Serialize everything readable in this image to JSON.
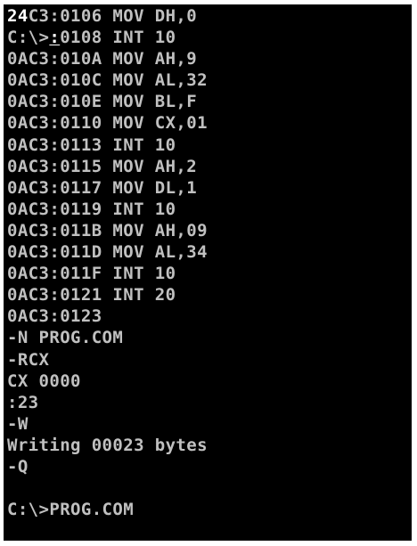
{
  "console": {
    "lines": [
      {
        "pre": "",
        "bright": "24",
        "rest": "C3:0106 MOV DH,0"
      },
      {
        "pre": "C:\\>",
        "under": ":",
        "rest": "0108 INT 10"
      },
      {
        "text": "0AC3:010A MOV AH,9"
      },
      {
        "text": "0AC3:010C MOV AL,32"
      },
      {
        "text": "0AC3:010E MOV BL,F"
      },
      {
        "text": "0AC3:0110 MOV CX,01"
      },
      {
        "text": "0AC3:0113 INT 10"
      },
      {
        "text": "0AC3:0115 MOV AH,2"
      },
      {
        "text": "0AC3:0117 MOV DL,1"
      },
      {
        "text": "0AC3:0119 INT 10"
      },
      {
        "text": "0AC3:011B MOV AH,09"
      },
      {
        "text": "0AC3:011D MOV AL,34"
      },
      {
        "text": "0AC3:011F INT 10"
      },
      {
        "text": "0AC3:0121 INT 20"
      },
      {
        "text": "0AC3:0123"
      },
      {
        "text": "-N PROG.COM"
      },
      {
        "text": "-RCX"
      },
      {
        "text": "CX 0000"
      },
      {
        "text": ":23"
      },
      {
        "text": "-W"
      },
      {
        "text": "Writing 00023 bytes"
      },
      {
        "text": "-Q"
      },
      {
        "text": ""
      },
      {
        "text": "C:\\>PROG.COM"
      }
    ]
  },
  "colors": {
    "background": "#000000",
    "text": "#c0c0c0",
    "highlight": "#ffffff"
  }
}
